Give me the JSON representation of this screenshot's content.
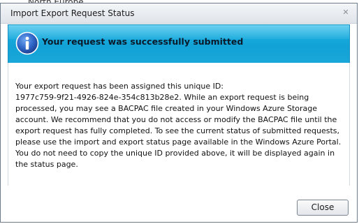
{
  "background": {
    "region_text": "North Europe"
  },
  "dialog": {
    "title": "Import Export Request Status",
    "close_glyph": "✕",
    "banner": {
      "title": "Your request was successfully submitted",
      "icon": "info-icon",
      "color": "#14a6da"
    },
    "message": "Your export request has been assigned this unique ID:\n1977c759-9f21-4926-824e-354c813b28e2. While an export request is being\nprocessed, you may see a BACPAC file created in your Windows Azure Storage\naccount. We recommend that you do not access or modify the BACPAC file until the\nexport request has fully completed. To see the current status of submitted requests,\nplease use the import and export status page available in the Windows Azure Portal.\nYou do not need to copy the unique ID provided above, it will be displayed again in\nthe status page.",
    "buttons": {
      "close_label": "Close"
    }
  }
}
